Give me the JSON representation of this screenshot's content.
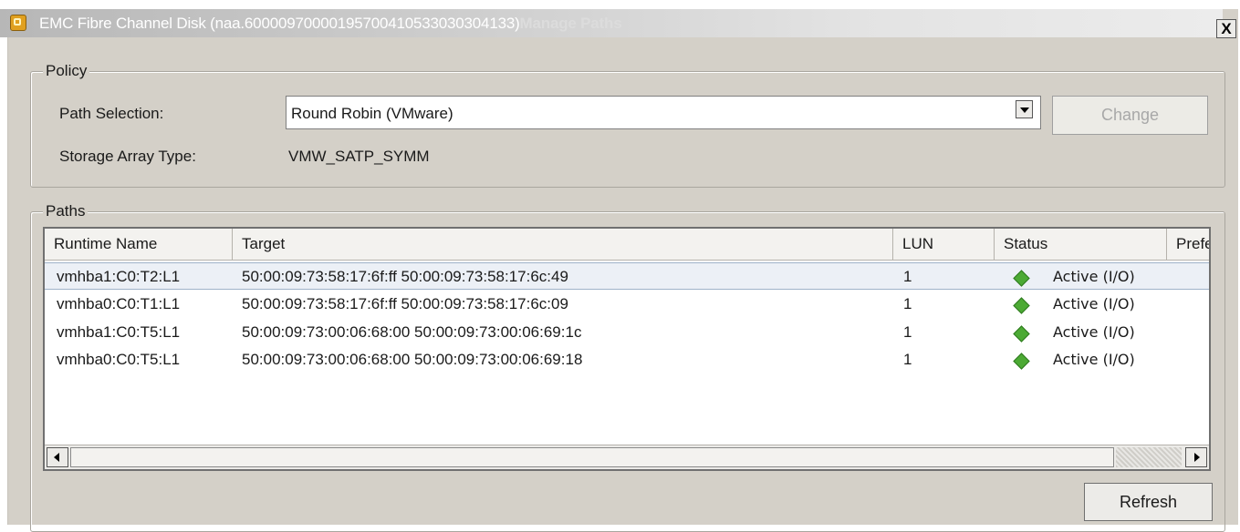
{
  "window": {
    "title": "EMC Fibre Channel Disk (naa.60000970000195700410533030304133)",
    "title_suffix": "Manage Paths",
    "close_label": "X"
  },
  "policy": {
    "legend": "Policy",
    "path_selection_label": "Path Selection:",
    "path_selection_value": "Round Robin (VMware)",
    "change_button": "Change",
    "storage_array_label": "Storage Array Type:",
    "storage_array_value": "VMW_SATP_SYMM"
  },
  "paths": {
    "legend": "Paths",
    "columns": [
      "Runtime Name",
      "Target",
      "LUN",
      "Status",
      "Preferred"
    ],
    "rows": [
      {
        "runtime": "vmhba1:C0:T2:L1",
        "target": "50:00:09:73:58:17:6f:ff 50:00:09:73:58:17:6c:49",
        "lun": "1",
        "status": "Active (I/O)",
        "selected": true
      },
      {
        "runtime": "vmhba0:C0:T1:L1",
        "target": "50:00:09:73:58:17:6f:ff 50:00:09:73:58:17:6c:09",
        "lun": "1",
        "status": "Active (I/O)",
        "selected": false
      },
      {
        "runtime": "vmhba1:C0:T5:L1",
        "target": "50:00:09:73:00:06:68:00 50:00:09:73:00:06:69:1c",
        "lun": "1",
        "status": "Active (I/O)",
        "selected": false
      },
      {
        "runtime": "vmhba0:C0:T5:L1",
        "target": "50:00:09:73:00:06:68:00 50:00:09:73:00:06:69:18",
        "lun": "1",
        "status": "Active (I/O)",
        "selected": false
      }
    ],
    "status_color": "#4caa34"
  },
  "footer": {
    "refresh_button": "Refresh"
  }
}
